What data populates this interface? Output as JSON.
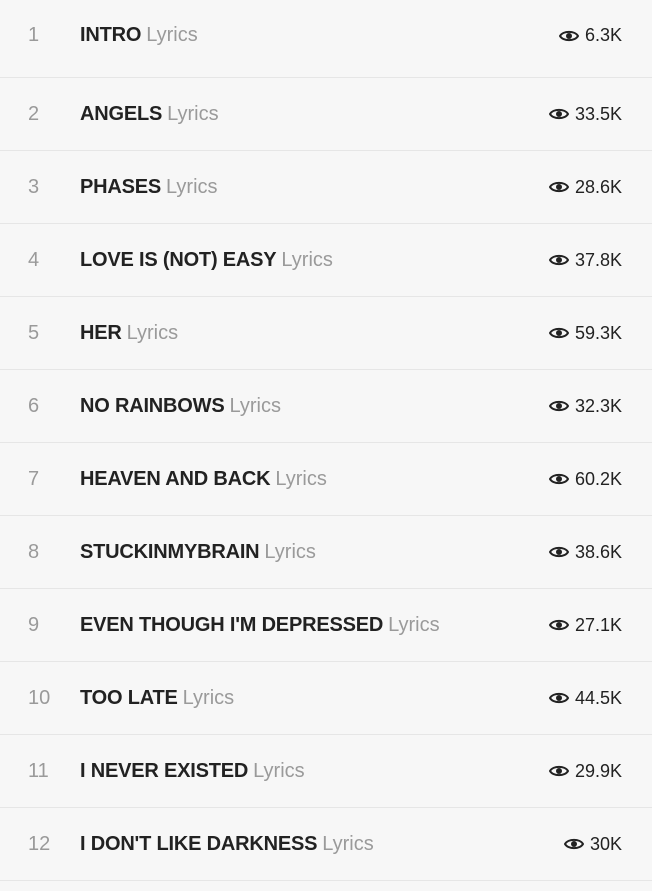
{
  "tracks": [
    {
      "num": "1",
      "title": "INTRO",
      "lyrics": "Lyrics",
      "views": "6.3K"
    },
    {
      "num": "2",
      "title": "ANGELS",
      "lyrics": "Lyrics",
      "views": "33.5K"
    },
    {
      "num": "3",
      "title": "PHASES",
      "lyrics": "Lyrics",
      "views": "28.6K"
    },
    {
      "num": "4",
      "title": "LOVE IS (NOT) EASY",
      "lyrics": "Lyrics",
      "views": "37.8K"
    },
    {
      "num": "5",
      "title": "HER",
      "lyrics": "Lyrics",
      "views": "59.3K"
    },
    {
      "num": "6",
      "title": "NO RAINBOWS",
      "lyrics": "Lyrics",
      "views": "32.3K"
    },
    {
      "num": "7",
      "title": "HEAVEN AND BACK",
      "lyrics": "Lyrics",
      "views": "60.2K"
    },
    {
      "num": "8",
      "title": "STUCKINMYBRAIN",
      "lyrics": "Lyrics",
      "views": "38.6K"
    },
    {
      "num": "9",
      "title": "EVEN THOUGH I'M DEPRESSED",
      "lyrics": "Lyrics",
      "views": "27.1K"
    },
    {
      "num": "10",
      "title": "TOO LATE",
      "lyrics": "Lyrics",
      "views": "44.5K"
    },
    {
      "num": "11",
      "title": "I NEVER EXISTED",
      "lyrics": "Lyrics",
      "views": "29.9K"
    },
    {
      "num": "12",
      "title": "I DON'T LIKE DARKNESS",
      "lyrics": "Lyrics",
      "views": "30K"
    }
  ],
  "icons": {
    "views": "eye-icon"
  },
  "colors": {
    "title": "#222222",
    "muted": "#9a9a9a",
    "background": "#f7f7f7",
    "divider": "#e6e6e6"
  }
}
